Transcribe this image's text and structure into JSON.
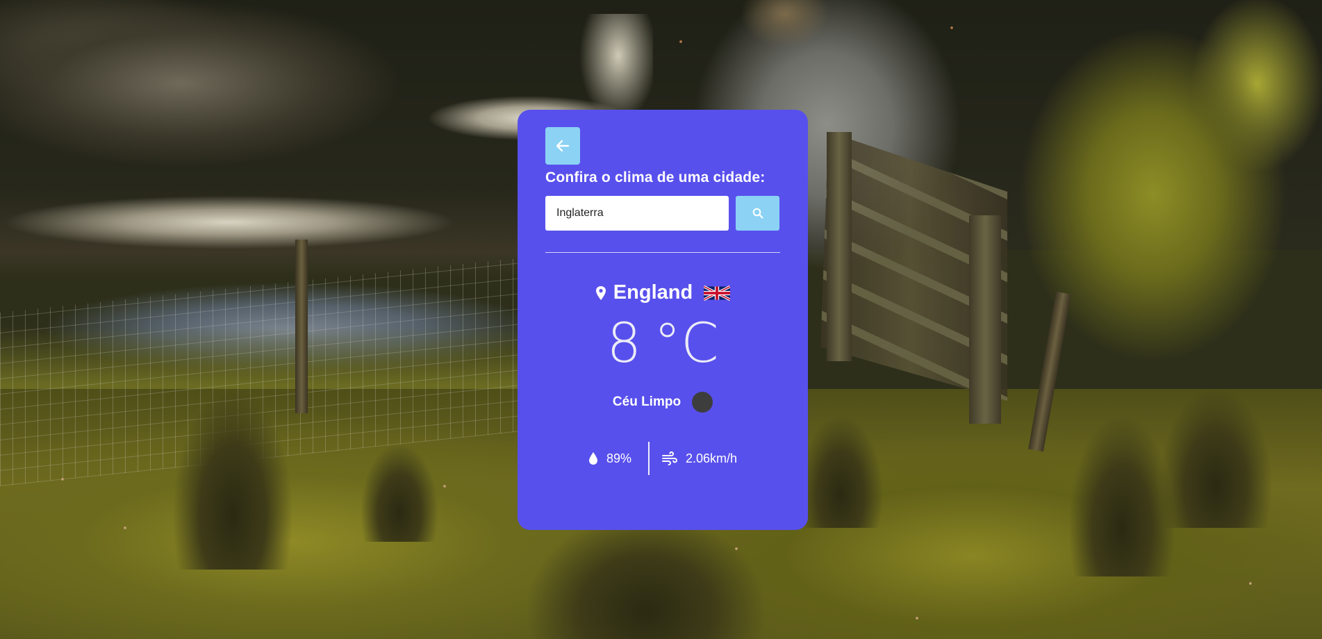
{
  "background": {
    "description_icon": "photo-background"
  },
  "card": {
    "accent_color": "#5850ec",
    "button_color": "#8bd2f4",
    "back_button_icon": "arrow-left-icon",
    "title": "Confira o clima de uma cidade:",
    "search": {
      "value": "Inglaterra",
      "button_icon": "search-icon"
    },
    "location": {
      "icon": "map-pin-icon",
      "city": "England",
      "flag_icon": "uk-flag-icon"
    },
    "temperature": {
      "value": "8",
      "unit": "°C"
    },
    "condition": {
      "label": "Céu Limpo",
      "icon": "weather-condition-icon"
    },
    "details": {
      "humidity": {
        "icon": "droplet-icon",
        "value": "89%"
      },
      "wind": {
        "icon": "wind-icon",
        "value": "2.06km/h"
      }
    }
  }
}
